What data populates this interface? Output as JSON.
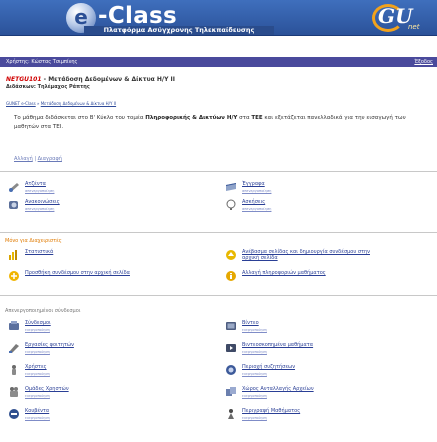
{
  "header": {
    "logo_letter": "e",
    "title": "-Class",
    "subtitle": "Πλατφόρμα Ασύγχρονης Τηλεκπαίδευσης",
    "partner_logo": "GU",
    "partner_sub": "net"
  },
  "userbar": {
    "user_text": "Χρήστης: Κώστας Τσιμπίνης",
    "logout": "Έξοδος"
  },
  "course": {
    "code": "NETGU101",
    "name": " - Μετάδοση Δεδομένων & Δίκτυα Η/Υ ΙΙ",
    "professor": "Διδάσκων: Τηλέμαχος Ράπτης"
  },
  "breadcrumb": [
    "GUNET e-Class",
    "Μετάδοση Δεδομένων & Δίκτυα Η/Υ ΙΙ"
  ],
  "breadcrumb_sep": " » ",
  "description": {
    "p1": "Το μάθημα διδάσκεται στο Β' Κύκλο του τομέα ",
    "bold1": "Πληροφορικής & Δικτύων Η/Υ",
    "p2": " στα ",
    "bold2": "ΤΕΕ",
    "p3": " και εξετάζεται πανελλαδικά για την εισαγωγή των μαθητών στα ΤΕΙ."
  },
  "desc_links": [
    "Αλλαγή",
    "Διαγραφή"
  ],
  "desc_links_sep": " | ",
  "tools": [
    {
      "title": "Ατζέντα",
      "sub": "απενεργοποίηση",
      "icon": "agenda-icon"
    },
    {
      "title": "Έγγραφα",
      "sub": "απενεργοποίηση",
      "icon": "documents-icon"
    },
    {
      "title": "Ανακοινώσεις",
      "sub": "απενεργοποίηση",
      "icon": "announcements-icon"
    },
    {
      "title": "Ασκήσεις",
      "sub": "απενεργοποίηση",
      "icon": "exercises-icon"
    }
  ],
  "admin_section": {
    "label": "Μόνο για Διαχειριστές",
    "tools": [
      {
        "title": "Στατιστικά",
        "icon": "statistics-icon"
      },
      {
        "title": "Ανέβασμα σελίδας και δημιουργία συνδέσμου στην",
        "title2": "αρχική σελίδα",
        "icon": "upload-page-icon"
      },
      {
        "title": "Προσθήκη συνδέσμου στην αρχική σελίδα",
        "icon": "add-link-icon"
      },
      {
        "title": "Αλλαγή πληροφοριών μαθήματος",
        "icon": "course-info-icon"
      }
    ]
  },
  "inactive_section": {
    "label": "Απενεργοποιημένοι σύνδεσμοι",
    "tools": [
      {
        "title": "Σύνδεσμοι",
        "sub": "ενεργοποίηση",
        "icon": "links-icon"
      },
      {
        "title": "Βίντεο",
        "sub": "ενεργοποίηση",
        "icon": "video-icon"
      },
      {
        "title": "Εργασίες φοιτητών",
        "sub": "ενεργοποίηση",
        "icon": "student-work-icon"
      },
      {
        "title": "Βιντεοσκοπημένα μαθήματα",
        "sub": "ενεργοποίηση",
        "icon": "video-lessons-icon"
      },
      {
        "title": "Χρήστες",
        "sub": "ενεργοποίηση",
        "icon": "users-icon"
      },
      {
        "title": "Περιοχή συζητήσεων",
        "sub": "ενεργοποίηση",
        "icon": "forum-icon"
      },
      {
        "title": "Ομάδες Χρηστών",
        "sub": "ενεργοποίηση",
        "icon": "user-groups-icon"
      },
      {
        "title": "Χώρος Ανταλλαγής Αρχείων",
        "sub": "ενεργοποίηση",
        "icon": "file-exchange-icon"
      },
      {
        "title": "Κουβέντα",
        "sub": "ενεργοποίηση",
        "icon": "chat-icon"
      },
      {
        "title": "Περιγραφή Μαθήματος",
        "sub": "ενεργοποίηση",
        "icon": "course-description-icon"
      }
    ]
  },
  "colors": {
    "banner": "#2b5299",
    "userbar": "#4a4a9c",
    "course_code": "#d00000",
    "link": "#2a3f96",
    "admin_label": "#e07a00"
  }
}
